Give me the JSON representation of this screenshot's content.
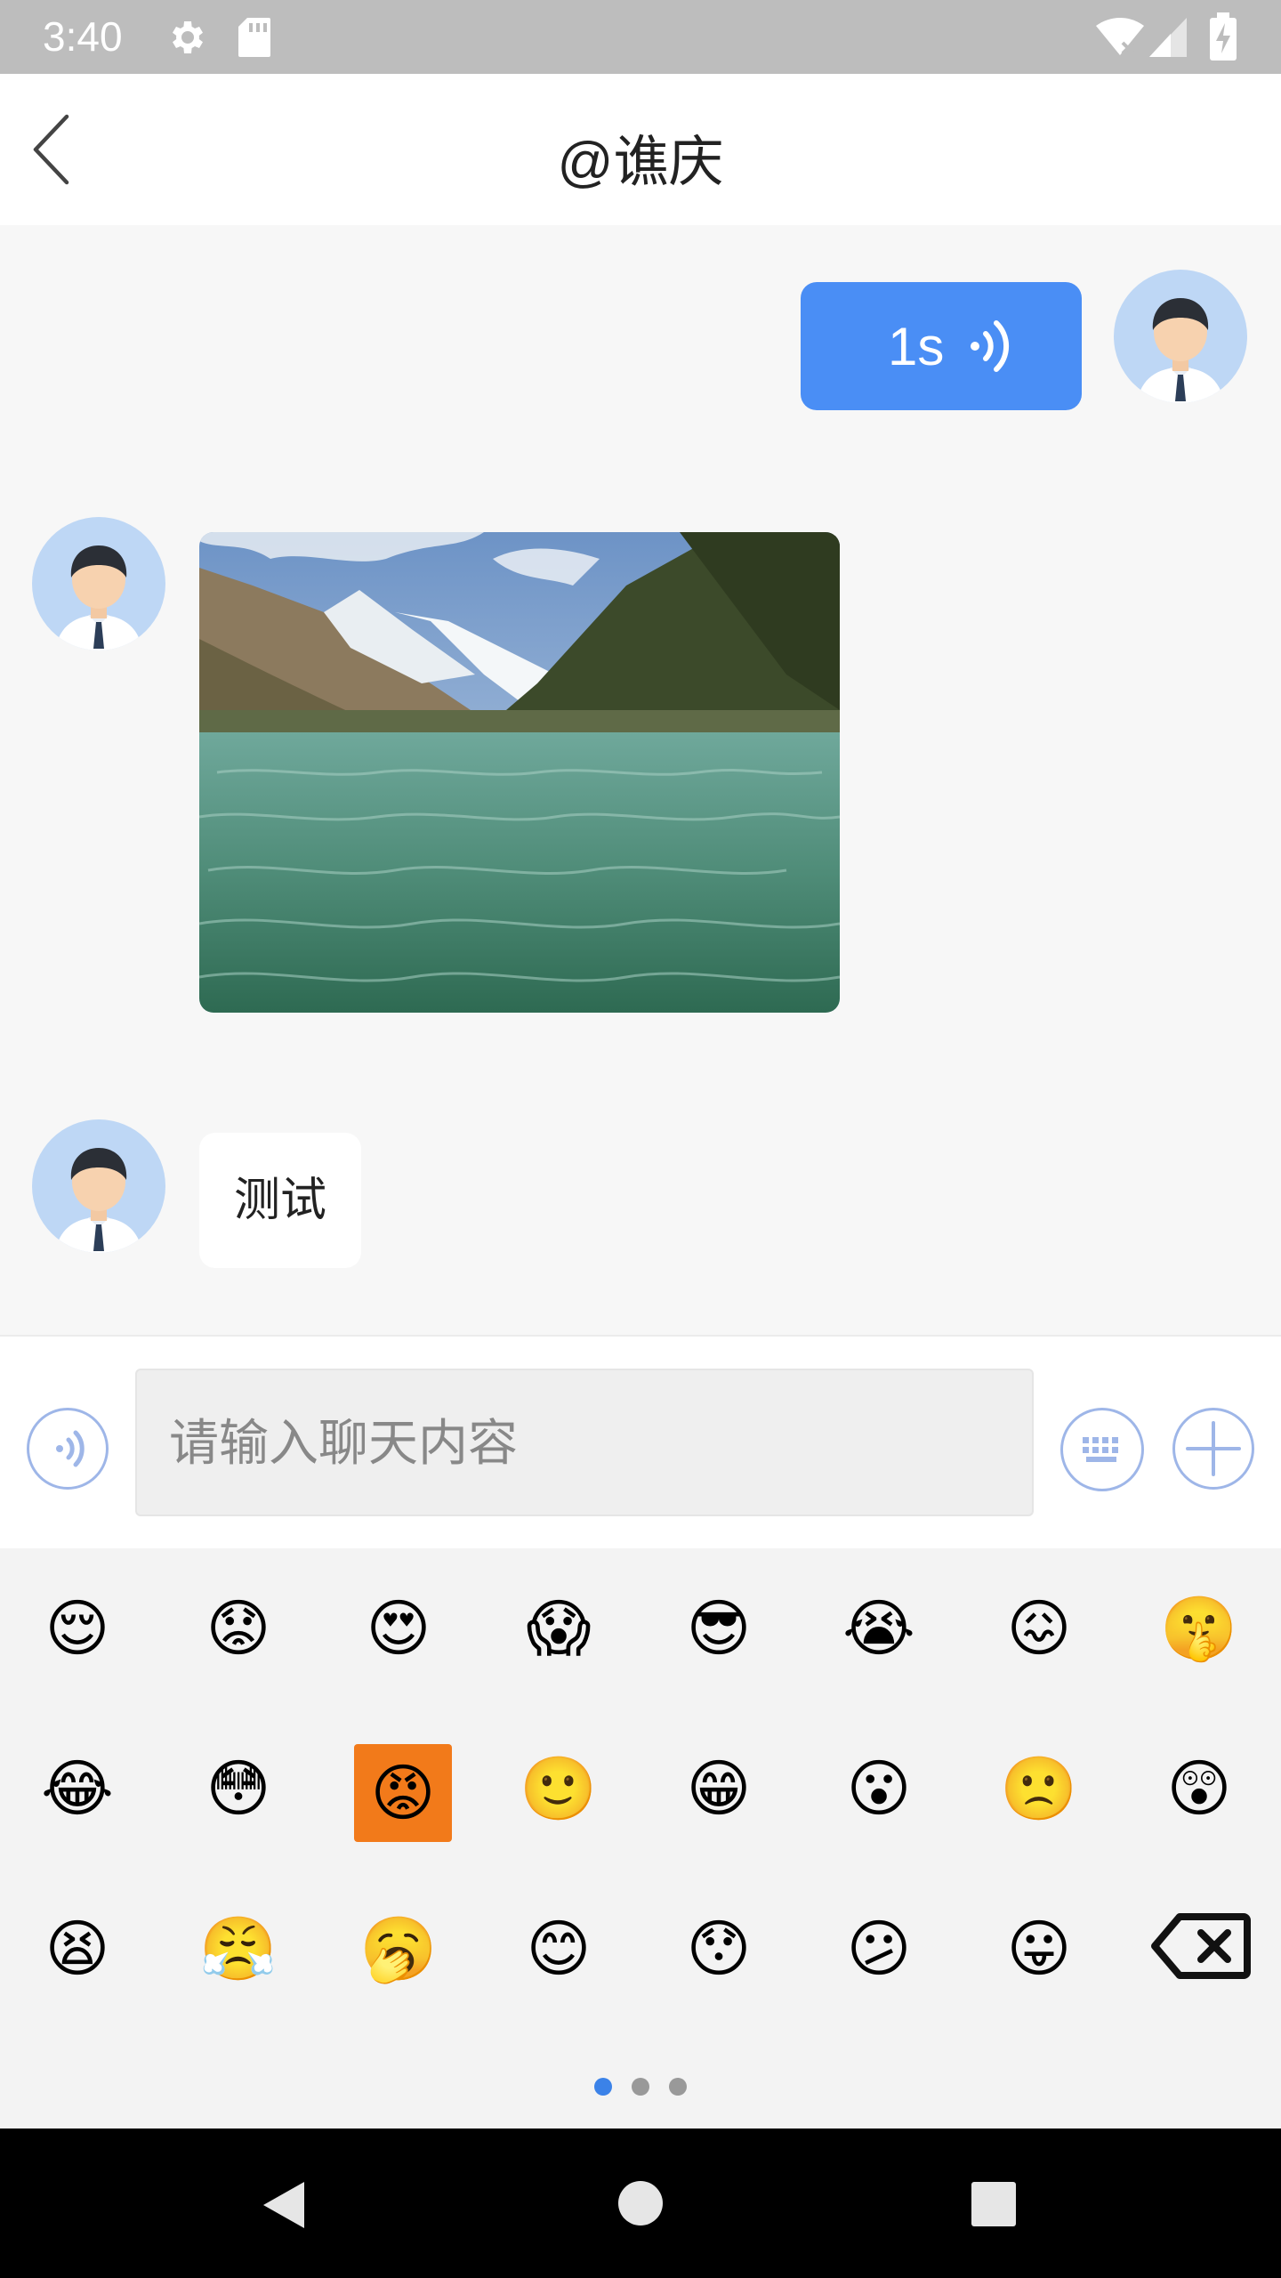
{
  "status_bar": {
    "time": "3:40"
  },
  "header": {
    "title": "@谯庆"
  },
  "messages": [
    {
      "type": "voice",
      "side": "right",
      "duration": "1s"
    },
    {
      "type": "image",
      "side": "left"
    },
    {
      "type": "text",
      "side": "left",
      "text": "测试"
    }
  ],
  "input": {
    "placeholder": "请输入聊天内容"
  },
  "emoji_panel": {
    "page_count": 3,
    "current_page": 1
  },
  "colors": {
    "accent": "#4a8ef5",
    "icon_outline": "#9eb6e8"
  }
}
